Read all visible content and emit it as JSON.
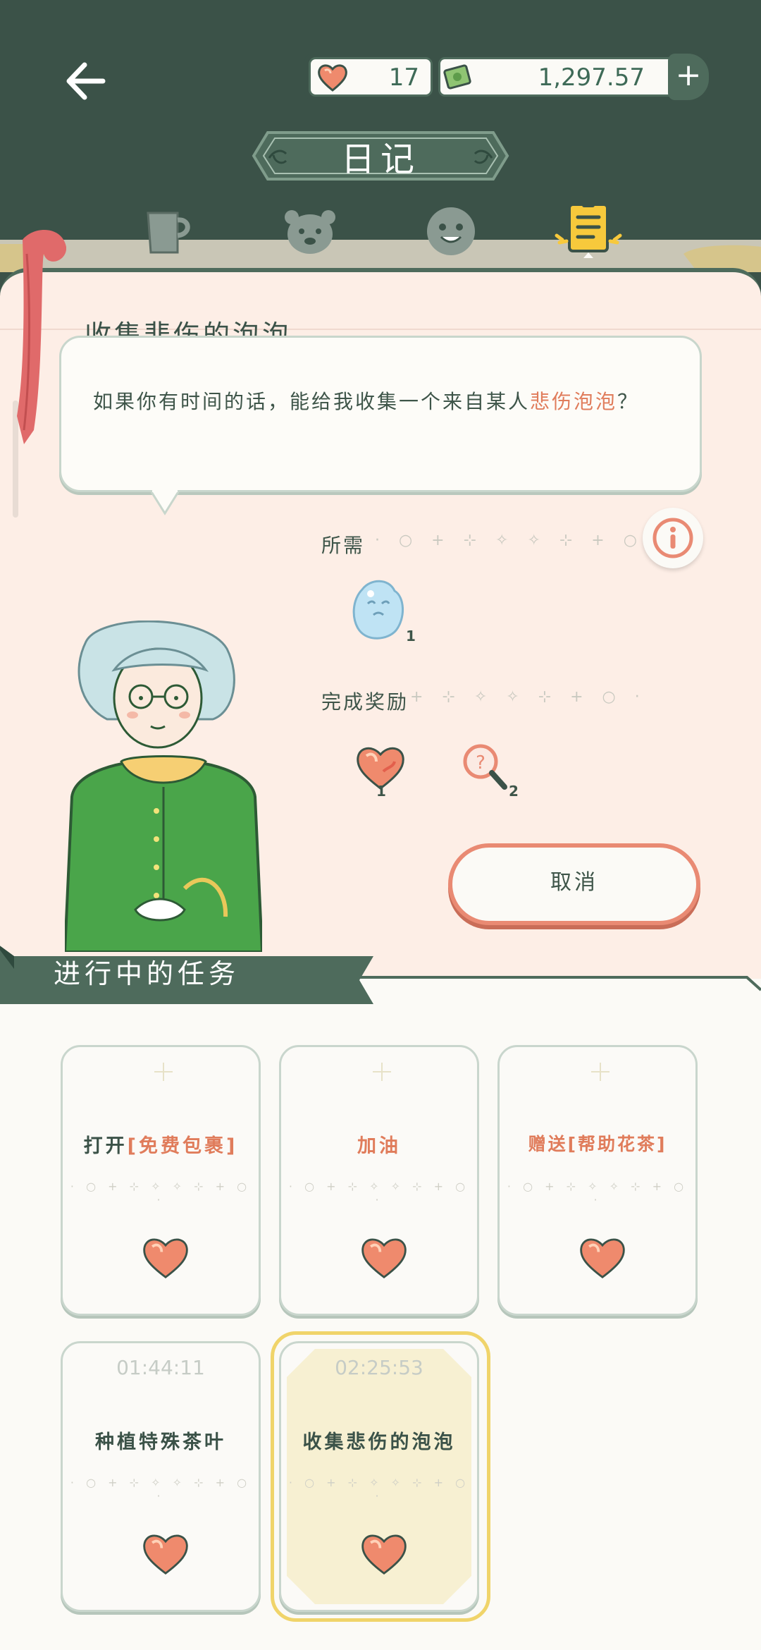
{
  "header": {
    "title": "日记",
    "hearts_value": "17",
    "money_value": "1,297.57",
    "plus_label": "+"
  },
  "tabs": [
    {
      "name": "cup-tab"
    },
    {
      "name": "bear-tab"
    },
    {
      "name": "face-tab"
    },
    {
      "name": "diary-tab",
      "active": true
    }
  ],
  "quest": {
    "title": "收集悲伤的泡泡",
    "text_before": "如果你有时间的话，能给我收集一个来自某人",
    "text_highlight": "悲伤泡泡",
    "text_after": "？",
    "required_label": "所需",
    "required_count": "1",
    "reward_label": "完成奖励",
    "reward_heart_count": "1",
    "reward_magnifier_count": "2",
    "cancel_label": "取消"
  },
  "tasks_section": {
    "title": "进行中的任务",
    "cards": [
      {
        "prefix": "打开",
        "highlight": "[免费包裹]",
        "timer": ""
      },
      {
        "prefix": "",
        "highlight": "加油",
        "timer": ""
      },
      {
        "prefix": "",
        "highlight": "赠送[帮助花茶]",
        "timer": ""
      },
      {
        "prefix": "种植特殊茶叶",
        "highlight": "",
        "timer": "01:44:11"
      },
      {
        "prefix": "收集悲伤的泡泡",
        "highlight": "",
        "timer": "02:25:53",
        "selected": true
      }
    ]
  },
  "colors": {
    "dark_green": "#3b5248",
    "accent_red": "#e07c5b",
    "paper_pink": "#fdeee6",
    "selected_yellow": "#f0d46a"
  }
}
